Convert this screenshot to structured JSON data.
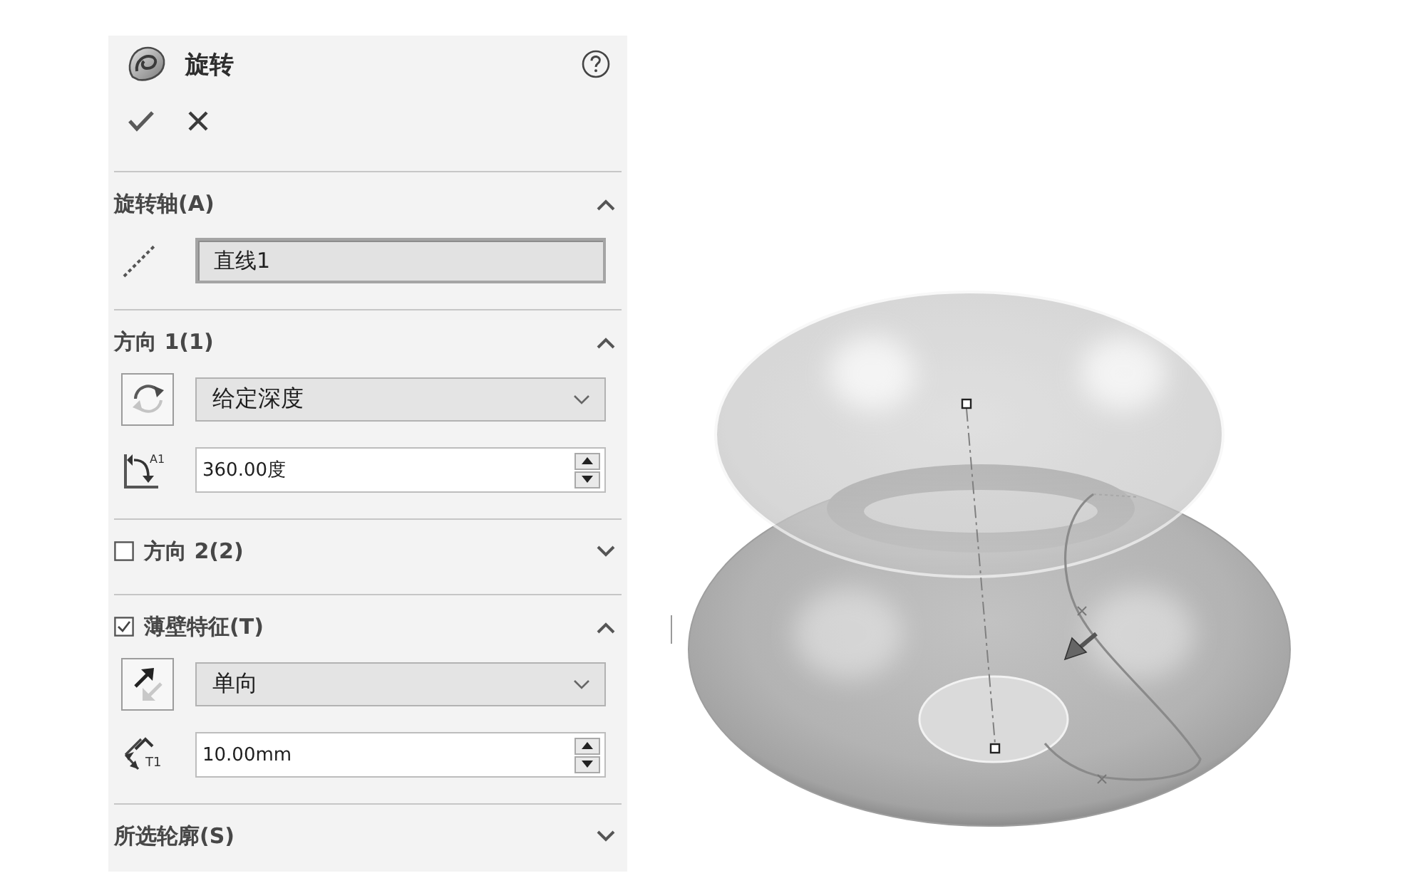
{
  "panel": {
    "title": "旋转",
    "sections": [
      {
        "label": "旋转轴(A)",
        "expanded": true,
        "rows": [
          {
            "kind": "selection",
            "value": "直线1"
          }
        ]
      },
      {
        "label": "方向 1(1)",
        "expanded": true,
        "rows": [
          {
            "kind": "dropdown",
            "value": "给定深度"
          },
          {
            "kind": "spinner",
            "value": "360.00度",
            "icon_label": "A1"
          }
        ]
      },
      {
        "label": "方向 2(2)",
        "checked": false,
        "expanded": false
      },
      {
        "label": "薄壁特征(T)",
        "checked": true,
        "expanded": true,
        "rows": [
          {
            "kind": "dropdown",
            "value": "单向"
          },
          {
            "kind": "spinner",
            "value": "10.00mm",
            "icon_label": "T1"
          }
        ]
      },
      {
        "label": "所选轮廓(S)",
        "expanded": false
      }
    ]
  }
}
